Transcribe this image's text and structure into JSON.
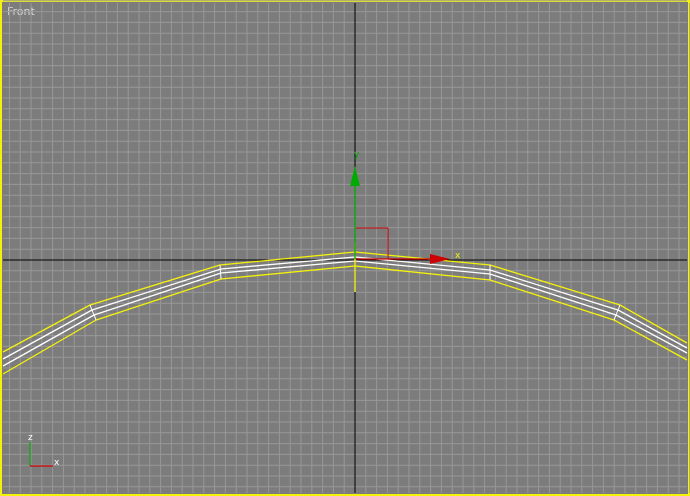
{
  "viewport": {
    "label": "Front",
    "active_border_color": "#f5f20a",
    "background_color": "#7c7c7c",
    "grid_color": "#989898",
    "home_grid_axis_color": "#000000"
  },
  "gizmo": {
    "x_label": "x",
    "y_label": "y",
    "x_color": "#cc0000",
    "y_color": "#00aa00"
  },
  "axis_tripod": {
    "x_label": "x",
    "z_label": "z",
    "x_color": "#cc0000",
    "z_color": "#00aa00"
  },
  "object": {
    "selection_color": "#f5f20a",
    "wire_color": "#ffffff"
  }
}
